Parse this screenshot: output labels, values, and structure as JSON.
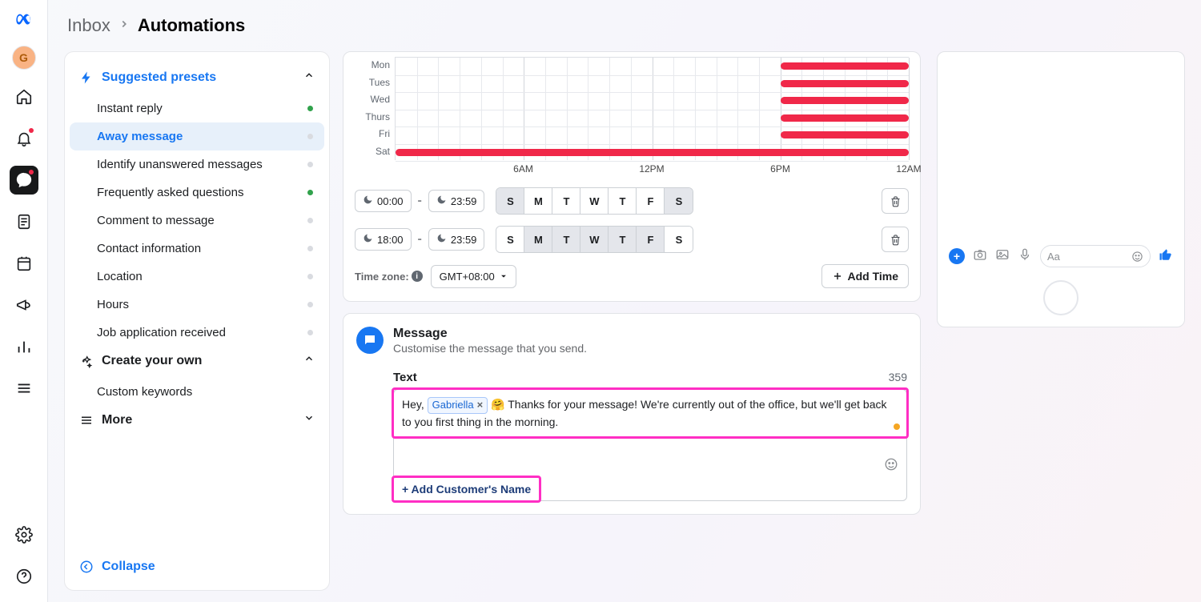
{
  "avatar_initial": "G",
  "breadcrumb": {
    "root": "Inbox",
    "current": "Automations"
  },
  "sidebar": {
    "suggested_title": "Suggested presets",
    "items": [
      {
        "label": "Instant reply",
        "status": "on",
        "selected": false
      },
      {
        "label": "Away message",
        "status": "off",
        "selected": true
      },
      {
        "label": "Identify unanswered messages",
        "status": "off",
        "selected": false
      },
      {
        "label": "Frequently asked questions",
        "status": "on",
        "selected": false
      },
      {
        "label": "Comment to message",
        "status": "off",
        "selected": false
      },
      {
        "label": "Contact information",
        "status": "off",
        "selected": false
      },
      {
        "label": "Location",
        "status": "off",
        "selected": false
      },
      {
        "label": "Hours",
        "status": "off",
        "selected": false
      },
      {
        "label": "Job application received",
        "status": "off",
        "selected": false
      }
    ],
    "create_title": "Create your own",
    "custom_items": [
      {
        "label": "Custom keywords"
      }
    ],
    "more_title": "More",
    "collapse_label": "Collapse"
  },
  "schedule": {
    "days": [
      "Mon",
      "Tues",
      "Wed",
      "Thurs",
      "Fri",
      "Sat"
    ],
    "axis": [
      "6AM",
      "12PM",
      "6PM",
      "12AM"
    ],
    "rows": [
      {
        "start": "00:00",
        "end": "23:59",
        "days_sel": [
          true,
          false,
          false,
          false,
          false,
          false,
          true
        ],
        "day_labels": [
          "S",
          "M",
          "T",
          "W",
          "T",
          "F",
          "S"
        ]
      },
      {
        "start": "18:00",
        "end": "23:59",
        "days_sel": [
          false,
          true,
          true,
          true,
          true,
          true,
          false
        ],
        "day_labels": [
          "S",
          "M",
          "T",
          "W",
          "T",
          "F",
          "S"
        ]
      }
    ],
    "tz_label": "Time zone:",
    "tz_value": "GMT+08:00",
    "add_time_label": "Add Time"
  },
  "message": {
    "title": "Message",
    "subtitle": "Customise the message that you send.",
    "text_label": "Text",
    "char_count": "359",
    "prefix": "Hey, ",
    "token": "Gabriella",
    "body": "🤗 Thanks for your message! We're currently out of the office, but we'll get back to you first thing in the morning.",
    "add_name_label": "+ Add Customer's Name"
  },
  "phone": {
    "placeholder": "Aa"
  }
}
